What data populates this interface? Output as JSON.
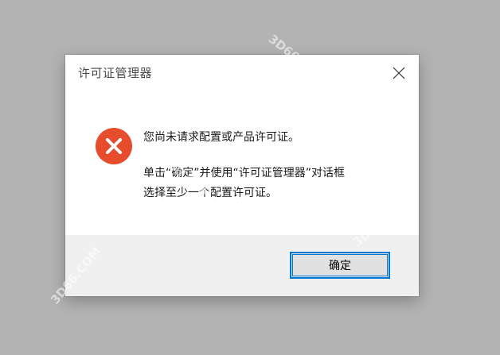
{
  "dialog": {
    "title": "许可证管理器",
    "message_line1": "您尚未请求配置或产品许可证。",
    "message_line2": "单击“确定”并使用“许可证管理器”对话框",
    "message_line3": "选择至少一个配置许可证。",
    "ok_label": "确定",
    "icon": "error-icon",
    "close_icon": "close-icon"
  },
  "watermarks": {
    "w1": "3D66.COM",
    "w2": "3D66.COM",
    "w3": "3D66.COM",
    "w4": "3D66.COM"
  },
  "colors": {
    "backdrop": "#b3b3b3",
    "error_red": "#e74c2c",
    "accent_blue": "#0078d7",
    "footer_bg": "#f0f0f0"
  }
}
